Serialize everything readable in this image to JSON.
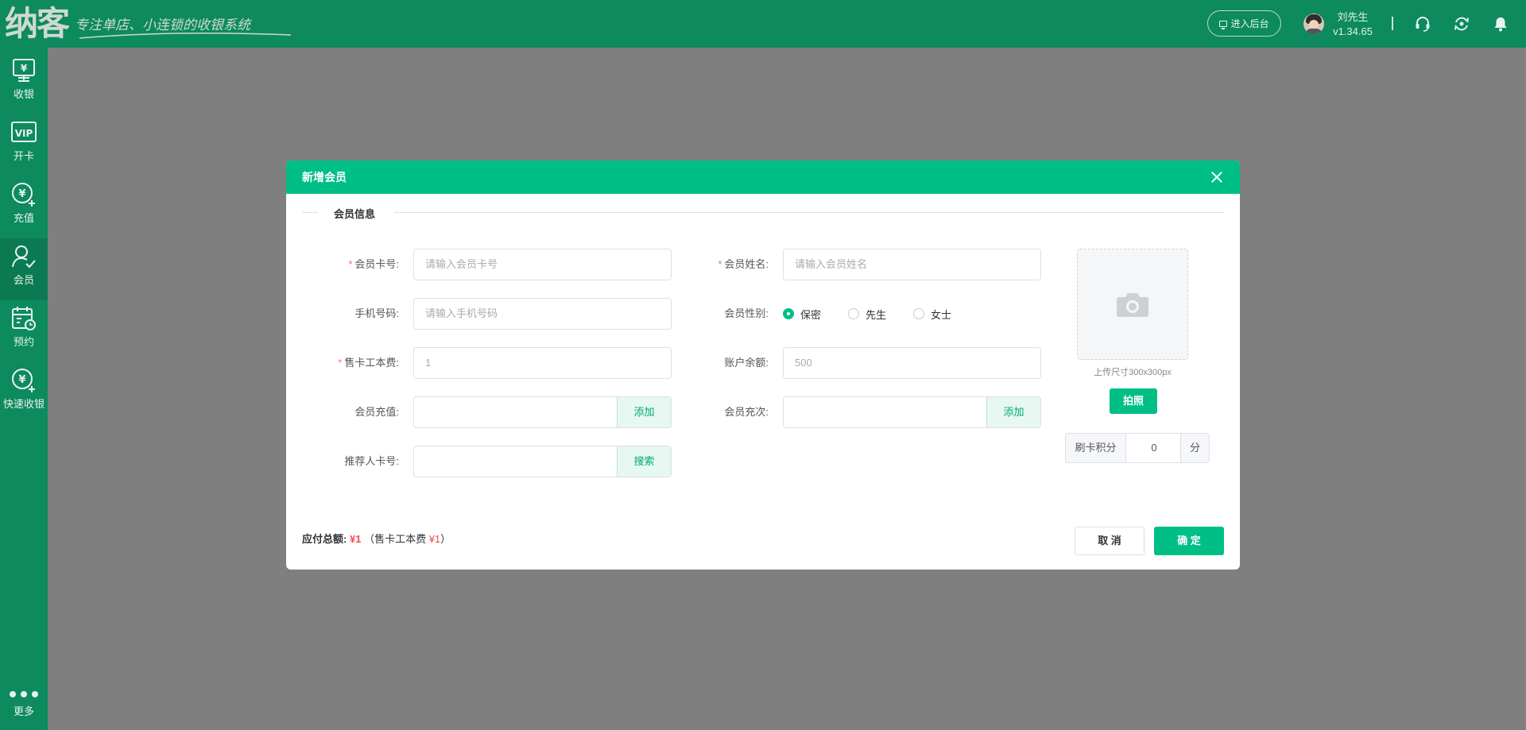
{
  "header": {
    "logo_text": "纳客",
    "slogan": "专注单店、小连锁的收银系统",
    "backend_button": "进入后台",
    "user_name": "刘先生",
    "version": "v1.34.65",
    "icons": [
      "headset-icon",
      "refresh-icon",
      "bell-icon"
    ]
  },
  "sidebar": {
    "items": [
      {
        "label": "收银",
        "icon": "cashier-icon"
      },
      {
        "label": "开卡",
        "icon": "vip-card-icon"
      },
      {
        "label": "充值",
        "icon": "recharge-icon"
      },
      {
        "label": "会员",
        "icon": "member-icon",
        "active": true
      },
      {
        "label": "预约",
        "icon": "calendar-icon"
      },
      {
        "label": "快速收银",
        "icon": "quick-cash-icon"
      }
    ],
    "more_label": "更多"
  },
  "modal": {
    "title": "新增会员",
    "section_title": "会员信息",
    "fields": {
      "card_no": {
        "label": "会员卡号:",
        "placeholder": "请输入会员卡号",
        "required": true
      },
      "name": {
        "label": "会员姓名:",
        "placeholder": "请输入会员姓名",
        "required": true
      },
      "phone": {
        "label": "手机号码:",
        "placeholder": "请输入手机号码"
      },
      "gender": {
        "label": "会员性别:",
        "options": [
          "保密",
          "先生",
          "女士"
        ],
        "selected": "保密"
      },
      "card_fee": {
        "label": "售卡工本费:",
        "value": "1",
        "required": true
      },
      "balance": {
        "label": "账户余额:",
        "value": "500"
      },
      "recharge": {
        "label": "会员充值:",
        "button": "添加"
      },
      "recharge_times": {
        "label": "会员充次:",
        "button": "添加"
      },
      "referrer": {
        "label": "推荐人卡号:",
        "button": "搜索"
      }
    },
    "upload_tip": "上传尺寸300x300px",
    "photo_button": "拍照",
    "points": {
      "prefix": "刷卡积分",
      "value": "0",
      "suffix": "分"
    },
    "footer": {
      "total_label": "应付总额:",
      "total_amount": "¥1",
      "detail_prefix": "（售卡工本费",
      "detail_amount": "¥1",
      "detail_suffix": "）"
    },
    "cancel_button": "取 消",
    "ok_button": "确 定"
  },
  "colors": {
    "brand_dark": "#0d8a5e",
    "accent": "#00bf86",
    "required": "#f56c6c",
    "amount": "#f24b4b"
  }
}
